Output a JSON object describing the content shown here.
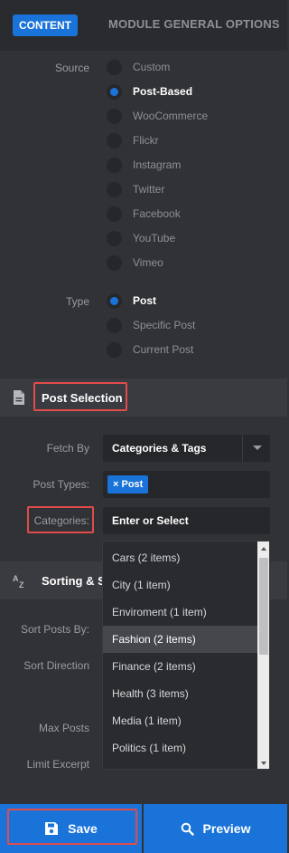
{
  "tabs": {
    "content": "CONTENT",
    "module": "MODULE GENERAL OPTIONS"
  },
  "source": {
    "label": "Source",
    "options": [
      "Custom",
      "Post-Based",
      "WooCommerce",
      "Flickr",
      "Instagram",
      "Twitter",
      "Facebook",
      "YouTube",
      "Vimeo"
    ],
    "selected": "Post-Based"
  },
  "type": {
    "label": "Type",
    "options": [
      "Post",
      "Specific Post",
      "Current Post"
    ],
    "selected": "Post"
  },
  "post_selection": {
    "title": "Post Selection",
    "icon": "document-icon",
    "fetch_by": {
      "label": "Fetch By",
      "value": "Categories & Tags"
    },
    "post_types": {
      "label": "Post Types:",
      "tag": "× Post"
    },
    "categories": {
      "label": "Categories:",
      "placeholder": "Enter or Select",
      "options": [
        "Cars (2 items)",
        "City (1 item)",
        "Enviroment (1 item)",
        "Fashion (2 items)",
        "Finance (2 items)",
        "Health (3 items)",
        "Media (1 item)",
        "Politics (1 item)"
      ],
      "highlighted": "Fashion (2 items)"
    }
  },
  "sorting": {
    "title": "Sorting & S",
    "icon": "sort-az-icon",
    "sort_posts_by": "Sort Posts By:",
    "sort_direction": "Sort Direction",
    "max_posts": "Max Posts",
    "limit_excerpt": "Limit Excerpt"
  },
  "buttons": {
    "save": "Save",
    "preview": "Preview"
  },
  "colors": {
    "accent": "#1a73d9",
    "highlight": "#e24b4b",
    "panel": "#313236",
    "section": "#3a3b40"
  }
}
